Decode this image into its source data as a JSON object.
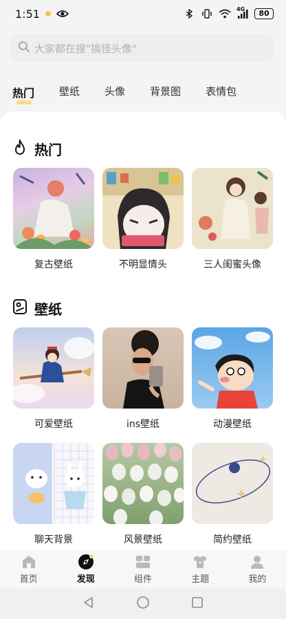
{
  "status_bar": {
    "time": "1:51",
    "signal_label": "4G",
    "battery": "80"
  },
  "search": {
    "placeholder": "大家都在搜\"搞怪头像\""
  },
  "tabs": [
    {
      "label": "热门",
      "active": true
    },
    {
      "label": "壁纸",
      "active": false
    },
    {
      "label": "头像",
      "active": false
    },
    {
      "label": "背景图",
      "active": false
    },
    {
      "label": "表情包",
      "active": false
    }
  ],
  "sections": [
    {
      "title": "热门",
      "icon": "flame-icon",
      "items": [
        {
          "label": "复古壁纸"
        },
        {
          "label": "不明显情头"
        },
        {
          "label": "三人闺蜜头像"
        }
      ]
    },
    {
      "title": "壁纸",
      "icon": "wallpaper-icon",
      "items": [
        {
          "label": "可爱壁纸"
        },
        {
          "label": "ins壁纸"
        },
        {
          "label": "动漫壁纸"
        },
        {
          "label": "聊天背景"
        },
        {
          "label": "风景壁纸"
        },
        {
          "label": "简约壁纸"
        }
      ]
    }
  ],
  "bottom_nav": [
    {
      "label": "首页",
      "icon": "home-icon",
      "active": false
    },
    {
      "label": "发现",
      "icon": "discover-icon",
      "active": true
    },
    {
      "label": "组件",
      "icon": "widgets-icon",
      "active": false
    },
    {
      "label": "主题",
      "icon": "theme-shirt-icon",
      "active": false
    },
    {
      "label": "我的",
      "icon": "profile-icon",
      "active": false
    }
  ],
  "colors": {
    "accent": "#f7d97a",
    "background": "#f4f4f6",
    "card_bg": "#ffffff"
  }
}
